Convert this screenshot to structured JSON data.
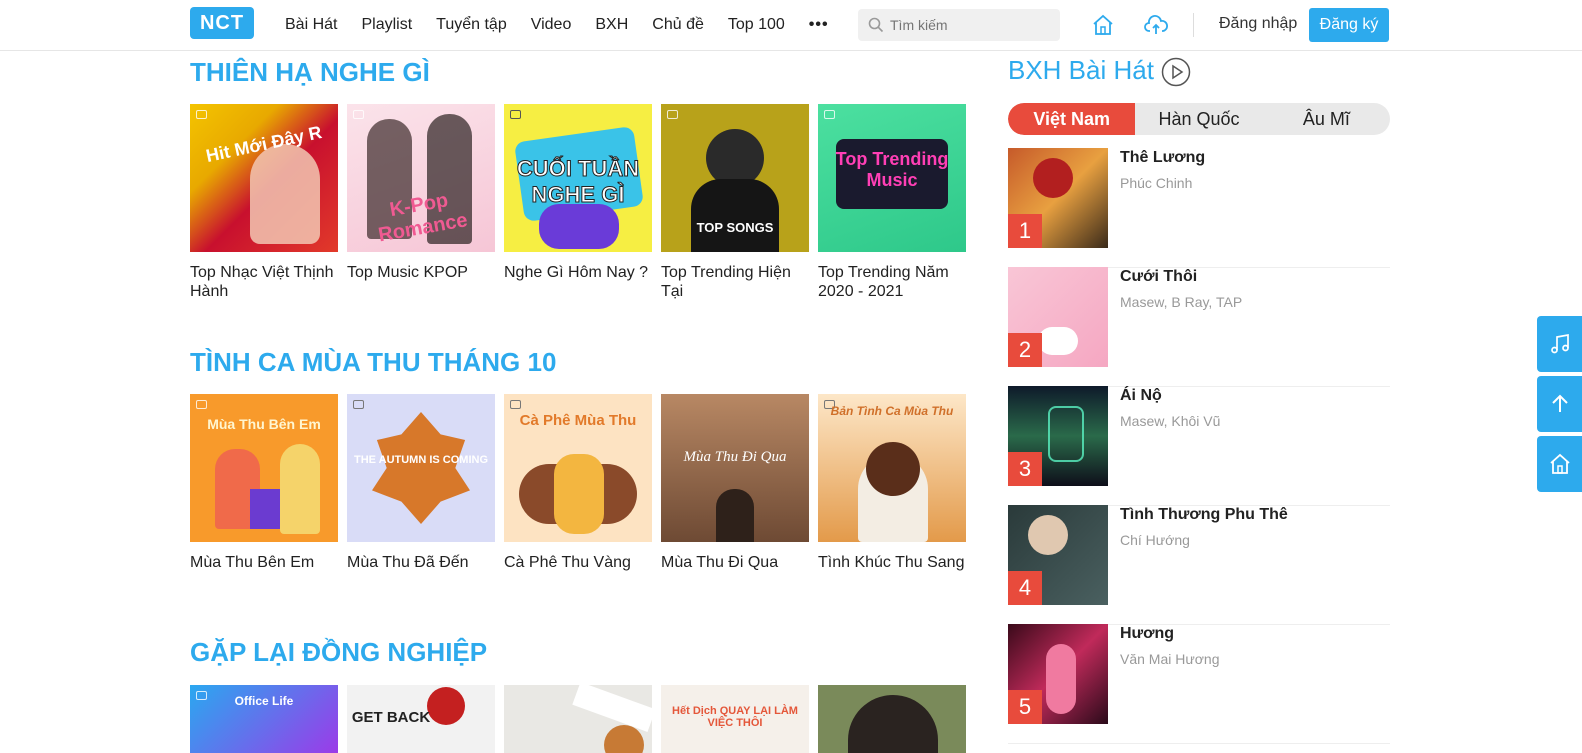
{
  "header": {
    "logo": "NCT",
    "nav": [
      "Bài Hát",
      "Playlist",
      "Tuyển tập",
      "Video",
      "BXH",
      "Chủ đề",
      "Top 100"
    ],
    "more": "•••",
    "search_placeholder": "Tìm kiếm",
    "login": "Đăng nhập",
    "register": "Đăng ký"
  },
  "sections": [
    {
      "title": "THIÊN HẠ NGHE GÌ",
      "items": [
        {
          "title": "Top Nhạc Việt Thịnh Hành",
          "art": "Hit Mới Đây R"
        },
        {
          "title": "Top Music KPOP",
          "art": "K-Pop Romance"
        },
        {
          "title": "Nghe Gì Hôm Nay ?",
          "art": "CUỐI TUẦN NGHE GÌ"
        },
        {
          "title": "Top Trending Hiện Tại",
          "art": "TOP SONGS"
        },
        {
          "title": "Top Trending Năm 2020 - 2021",
          "art": "Top Trending Music"
        }
      ]
    },
    {
      "title": "TÌNH CA MÙA THU THÁNG 10",
      "items": [
        {
          "title": "Mùa Thu Bên Em",
          "art": "Mùa Thu Bên Em"
        },
        {
          "title": "Mùa Thu Đã Đến",
          "art": "THE AUTUMN IS COMING"
        },
        {
          "title": "Cà Phê Thu Vàng",
          "art": "Cà Phê Mùa Thu"
        },
        {
          "title": "Mùa Thu Đi Qua",
          "art": "Mùa Thu Đi Qua"
        },
        {
          "title": "Tình Khúc Thu Sang",
          "art": "Bản Tình Ca Mùa Thu"
        }
      ]
    },
    {
      "title": "GẶP LẠI ĐỒNG NGHIỆP",
      "items": [
        {
          "title": "",
          "art": "Office Life"
        },
        {
          "title": "",
          "art": "GET BACK"
        },
        {
          "title": "",
          "art": ""
        },
        {
          "title": "",
          "art": "Hết Dịch QUAY LẠI LÀM VIỆC THÔI"
        },
        {
          "title": "",
          "art": ""
        }
      ]
    }
  ],
  "chart": {
    "title": "BXH Bài Hát",
    "tabs": [
      "Việt Nam",
      "Hàn Quốc",
      "Âu Mĩ"
    ],
    "songs": [
      {
        "rank": "1",
        "title": "Thê Lương",
        "artist": "Phúc Chinh"
      },
      {
        "rank": "2",
        "title": "Cưới Thôi",
        "artist": "Masew, B Ray, TAP"
      },
      {
        "rank": "3",
        "title": "Ái Nộ",
        "artist": "Masew, Khôi Vũ"
      },
      {
        "rank": "4",
        "title": "Tình Thương Phu Thê",
        "artist": "Chí Hướng"
      },
      {
        "rank": "5",
        "title": "Hương",
        "artist": "Văn Mai Hương"
      }
    ]
  }
}
